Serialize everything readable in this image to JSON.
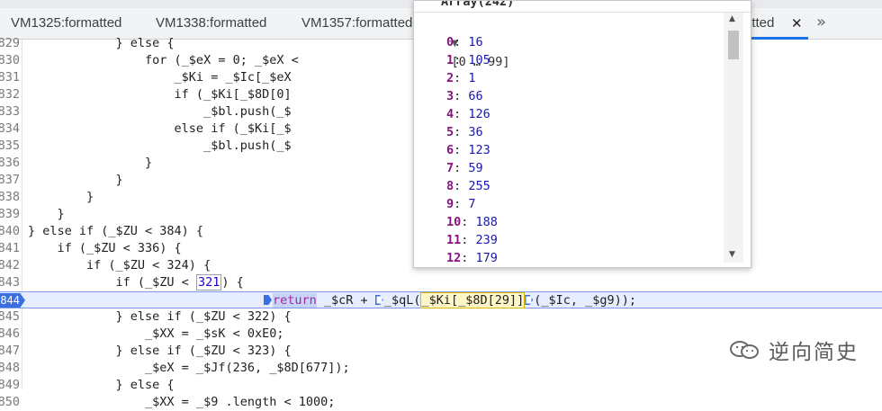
{
  "tabs": [
    {
      "label": "VM1325:formatted"
    },
    {
      "label": "VM1338:formatted"
    },
    {
      "label": "VM1357:formatted"
    },
    {
      "label": "atted"
    }
  ],
  "tab_close": "✕",
  "tab_more": "»",
  "popover": {
    "title": "Array(242)",
    "range_label": "[0 … 99]",
    "items": [
      {
        "k": "0",
        "v": "16"
      },
      {
        "k": "1",
        "v": "105"
      },
      {
        "k": "2",
        "v": "1"
      },
      {
        "k": "3",
        "v": "66"
      },
      {
        "k": "4",
        "v": "126"
      },
      {
        "k": "5",
        "v": "36"
      },
      {
        "k": "6",
        "v": "123"
      },
      {
        "k": "7",
        "v": "59"
      },
      {
        "k": "8",
        "v": "255"
      },
      {
        "k": "9",
        "v": "7"
      },
      {
        "k": "10",
        "v": "188"
      },
      {
        "k": "11",
        "v": "239"
      },
      {
        "k": "12",
        "v": "179"
      }
    ]
  },
  "code": {
    "lines": [
      {
        "n": "829",
        "t": "            } else {"
      },
      {
        "n": "830",
        "t": "                for (_$eX = 0; _$eX <"
      },
      {
        "n": "831",
        "t": "                    _$Ki = _$Ic[_$eX"
      },
      {
        "n": "832",
        "t": "                    if (_$Ki[_$8D[0]"
      },
      {
        "n": "833",
        "t": "                        _$bl.push(_$"
      },
      {
        "n": "834",
        "t": "                    else if (_$Ki[_$"
      },
      {
        "n": "835",
        "t": "                        _$bl.push(_$"
      },
      {
        "n": "836",
        "t": "                }"
      },
      {
        "n": "837",
        "t": "            }"
      },
      {
        "n": "838",
        "t": "        }"
      },
      {
        "n": "839",
        "t": "    }"
      },
      {
        "n": "840",
        "t": "} else if (_$ZU < 384) {"
      },
      {
        "n": "841",
        "t": "    if (_$ZU < 336) {"
      },
      {
        "n": "842",
        "t": "        if (_$ZU < 324) {"
      },
      {
        "n": "843",
        "pre": "            if (_$ZU < ",
        "num": "321",
        "post": ") {"
      },
      {
        "n": "844",
        "exec": true
      },
      {
        "n": "845",
        "t": "            } else if (_$ZU < 322) {"
      },
      {
        "n": "846",
        "t": "                _$XX = _$sK < 0xE0;"
      },
      {
        "n": "847",
        "t": "            } else if (_$ZU < 323) {"
      },
      {
        "n": "848",
        "t": "                _$eX = _$Jf(236, _$8D[677]);"
      },
      {
        "n": "849",
        "t": "            } else {"
      },
      {
        "n": "850",
        "t": "                _$XX = _$9 .length < 1000;"
      }
    ],
    "exec_line": {
      "kw": "return",
      "a": " _$cR + ",
      "b": "_$qL(",
      "c": "_$Ki[_$8D[29]]",
      "d": "(_$Ic, _$g9)",
      "e": ");"
    }
  },
  "watermark": {
    "text": "逆向简史"
  }
}
